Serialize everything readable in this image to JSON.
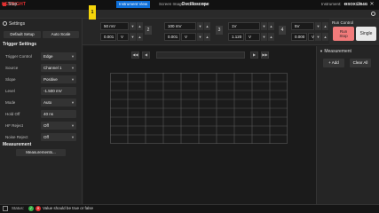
{
  "app": {
    "logo": "KEYSIGHT",
    "title": "Oscilloscope"
  },
  "tabbar": {
    "stop_label": "Stop",
    "tabs": [
      {
        "label": "Instrument View"
      },
      {
        "label": "Screen Image"
      },
      {
        "label": "Trace Data"
      }
    ],
    "instrument_label": "Instrument:",
    "instrument_value": "DSOX1204G"
  },
  "left_panel": {
    "settings_label": "Settings",
    "default_setup_label": "Default Setup",
    "auto_scale_label": "Auto Scale",
    "trigger_settings_title": "Trigger Settings",
    "trigger_rows": [
      {
        "label": "Trigger Control",
        "value": "Edge"
      },
      {
        "label": "Source",
        "value": "Channel 1"
      },
      {
        "label": "Slope",
        "value": "Positive"
      },
      {
        "label": "Level",
        "value": "-1.500 mV"
      },
      {
        "label": "Mode",
        "value": "Auto"
      },
      {
        "label": "Hold Off",
        "value": "40 ns"
      },
      {
        "label": "HF Reject",
        "value": "Off"
      },
      {
        "label": "Noise Reject",
        "value": "Off"
      }
    ],
    "measurement_title": "Measurement",
    "measurements_button": "Measurements..."
  },
  "channels": [
    {
      "num": "1",
      "scale": "50 mV",
      "offset": "0.001",
      "unit": "V",
      "color": "#f5d50a"
    },
    {
      "num": "2",
      "scale": "100 mV",
      "offset": "0.001",
      "unit": "V",
      "color": "#3bd14a"
    },
    {
      "num": "3",
      "scale": "1V",
      "offset": "1.120",
      "unit": "V",
      "color": "#4aa6f0"
    },
    {
      "num": "4",
      "scale": "5V",
      "offset": "0.000",
      "unit": "V",
      "color": "#f06bc8"
    }
  ],
  "run_control": {
    "title": "Run Control",
    "run_label": "Run\nStop",
    "single_label": "Single"
  },
  "right_panel": {
    "measurement_label": "Measurement",
    "add_label": "+ Add",
    "clear_all_label": "Clear All"
  },
  "status": {
    "label": "Status:",
    "message": "Value should be true or false"
  },
  "colors": {
    "accent": "#0e6fd8",
    "stop": "#e03030",
    "run": "#f27b7b"
  }
}
